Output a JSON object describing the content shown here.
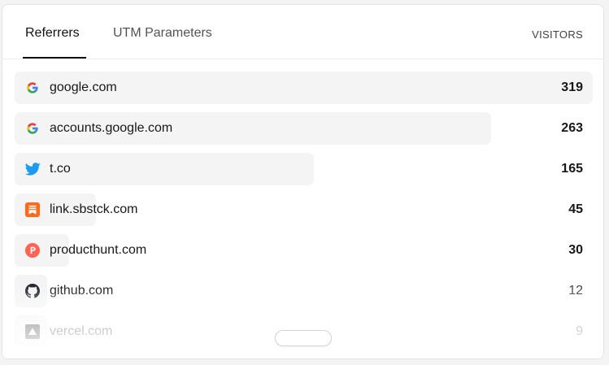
{
  "tabs": [
    {
      "label": "Referrers",
      "active": true
    },
    {
      "label": "UTM Parameters",
      "active": false
    }
  ],
  "column_header": "VISITORS",
  "referrers": [
    {
      "name": "google.com",
      "visitors": "319",
      "icon": "google-icon",
      "share": 1.0
    },
    {
      "name": "accounts.google.com",
      "visitors": "263",
      "icon": "google-icon",
      "share": 0.824
    },
    {
      "name": "t.co",
      "visitors": "165",
      "icon": "twitter-icon",
      "share": 0.517
    },
    {
      "name": "link.sbstck.com",
      "visitors": "45",
      "icon": "substack-icon",
      "share": 0.141
    },
    {
      "name": "producthunt.com",
      "visitors": "30",
      "icon": "producthunt-icon",
      "share": 0.094
    },
    {
      "name": "github.com",
      "visitors": "12",
      "icon": "github-icon",
      "share": 0.038
    },
    {
      "name": "vercel.com",
      "visitors": "9",
      "icon": "vercel-icon",
      "share": 0.028
    }
  ],
  "colors": {
    "bar": "#f4f4f5",
    "twitter": "#1d9bf0",
    "substack": "#ff6719",
    "producthunt": "#ff6154",
    "github": "#24292f"
  }
}
